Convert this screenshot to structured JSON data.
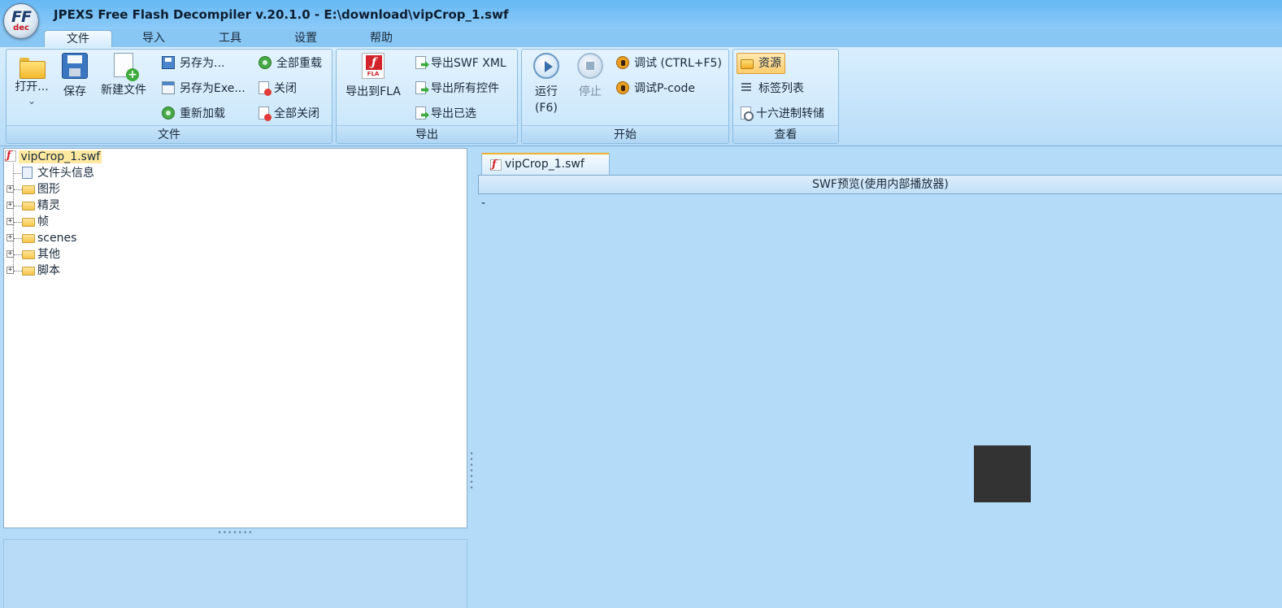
{
  "window": {
    "title": "JPEXS Free Flash Decompiler v.20.1.0 - E:\\download\\vipCrop_1.swf",
    "logo_text": "FF",
    "logo_sub": "dec"
  },
  "menu": {
    "tabs": [
      {
        "label": "文件",
        "active": true
      },
      {
        "label": "导入"
      },
      {
        "label": "工具"
      },
      {
        "label": "设置"
      },
      {
        "label": "帮助"
      }
    ]
  },
  "ribbon": {
    "file_group": {
      "label": "文件",
      "open_label": "打开...",
      "open_chevron": "⌄",
      "save_label": "保存",
      "new_label": "新建文件",
      "save_as_label": "另存为...",
      "save_as_exe_label": "另存为Exe...",
      "reload_label": "重新加载",
      "reload_all_label": "全部重载",
      "close_label": "关闭",
      "close_all_label": "全部关闭"
    },
    "export_group": {
      "label": "导出",
      "export_fla_label": "导出到FLA",
      "export_xml_label": "导出SWF XML",
      "export_all_label": "导出所有控件",
      "export_selected_label": "导出已选"
    },
    "start_group": {
      "label": "开始",
      "run_label": "运行",
      "run_shortcut": "(F6)",
      "stop_label": "停止",
      "debug_label": "调试 (CTRL+F5)",
      "debug_pcode_label": "调试P-code"
    },
    "view_group": {
      "label": "查看",
      "resources_label": "资源",
      "tag_list_label": "标签列表",
      "hex_dump_label": "十六进制转储"
    }
  },
  "tree": {
    "root": "vipCrop_1.swf",
    "nodes": [
      {
        "label": "文件头信息",
        "expandable": false,
        "icon": "document-icon"
      },
      {
        "label": "图形",
        "expandable": true,
        "icon": "shapes-folder-icon"
      },
      {
        "label": "精灵",
        "expandable": true,
        "icon": "sprites-folder-icon"
      },
      {
        "label": "帧",
        "expandable": true,
        "icon": "frames-folder-icon"
      },
      {
        "label": "scenes",
        "expandable": true,
        "icon": "scenes-folder-icon"
      },
      {
        "label": "其他",
        "expandable": true,
        "icon": "folder-icon"
      },
      {
        "label": "脚本",
        "expandable": true,
        "icon": "folder-icon"
      }
    ],
    "expander_symbol": "+"
  },
  "splitters": {
    "horizontal_grip": "•••••••",
    "vertical_grip": "•\n•\n•\n•\n•\n•\n•"
  },
  "preview": {
    "tab_label": "vipCrop_1.swf",
    "header": "SWF预览(使用内部播放器)",
    "status_text": "-",
    "square_color": "#333333"
  },
  "colors": {
    "background": "#b4dcf8",
    "title_bar": "#66b8f4",
    "selection": "#ffe9a0"
  }
}
